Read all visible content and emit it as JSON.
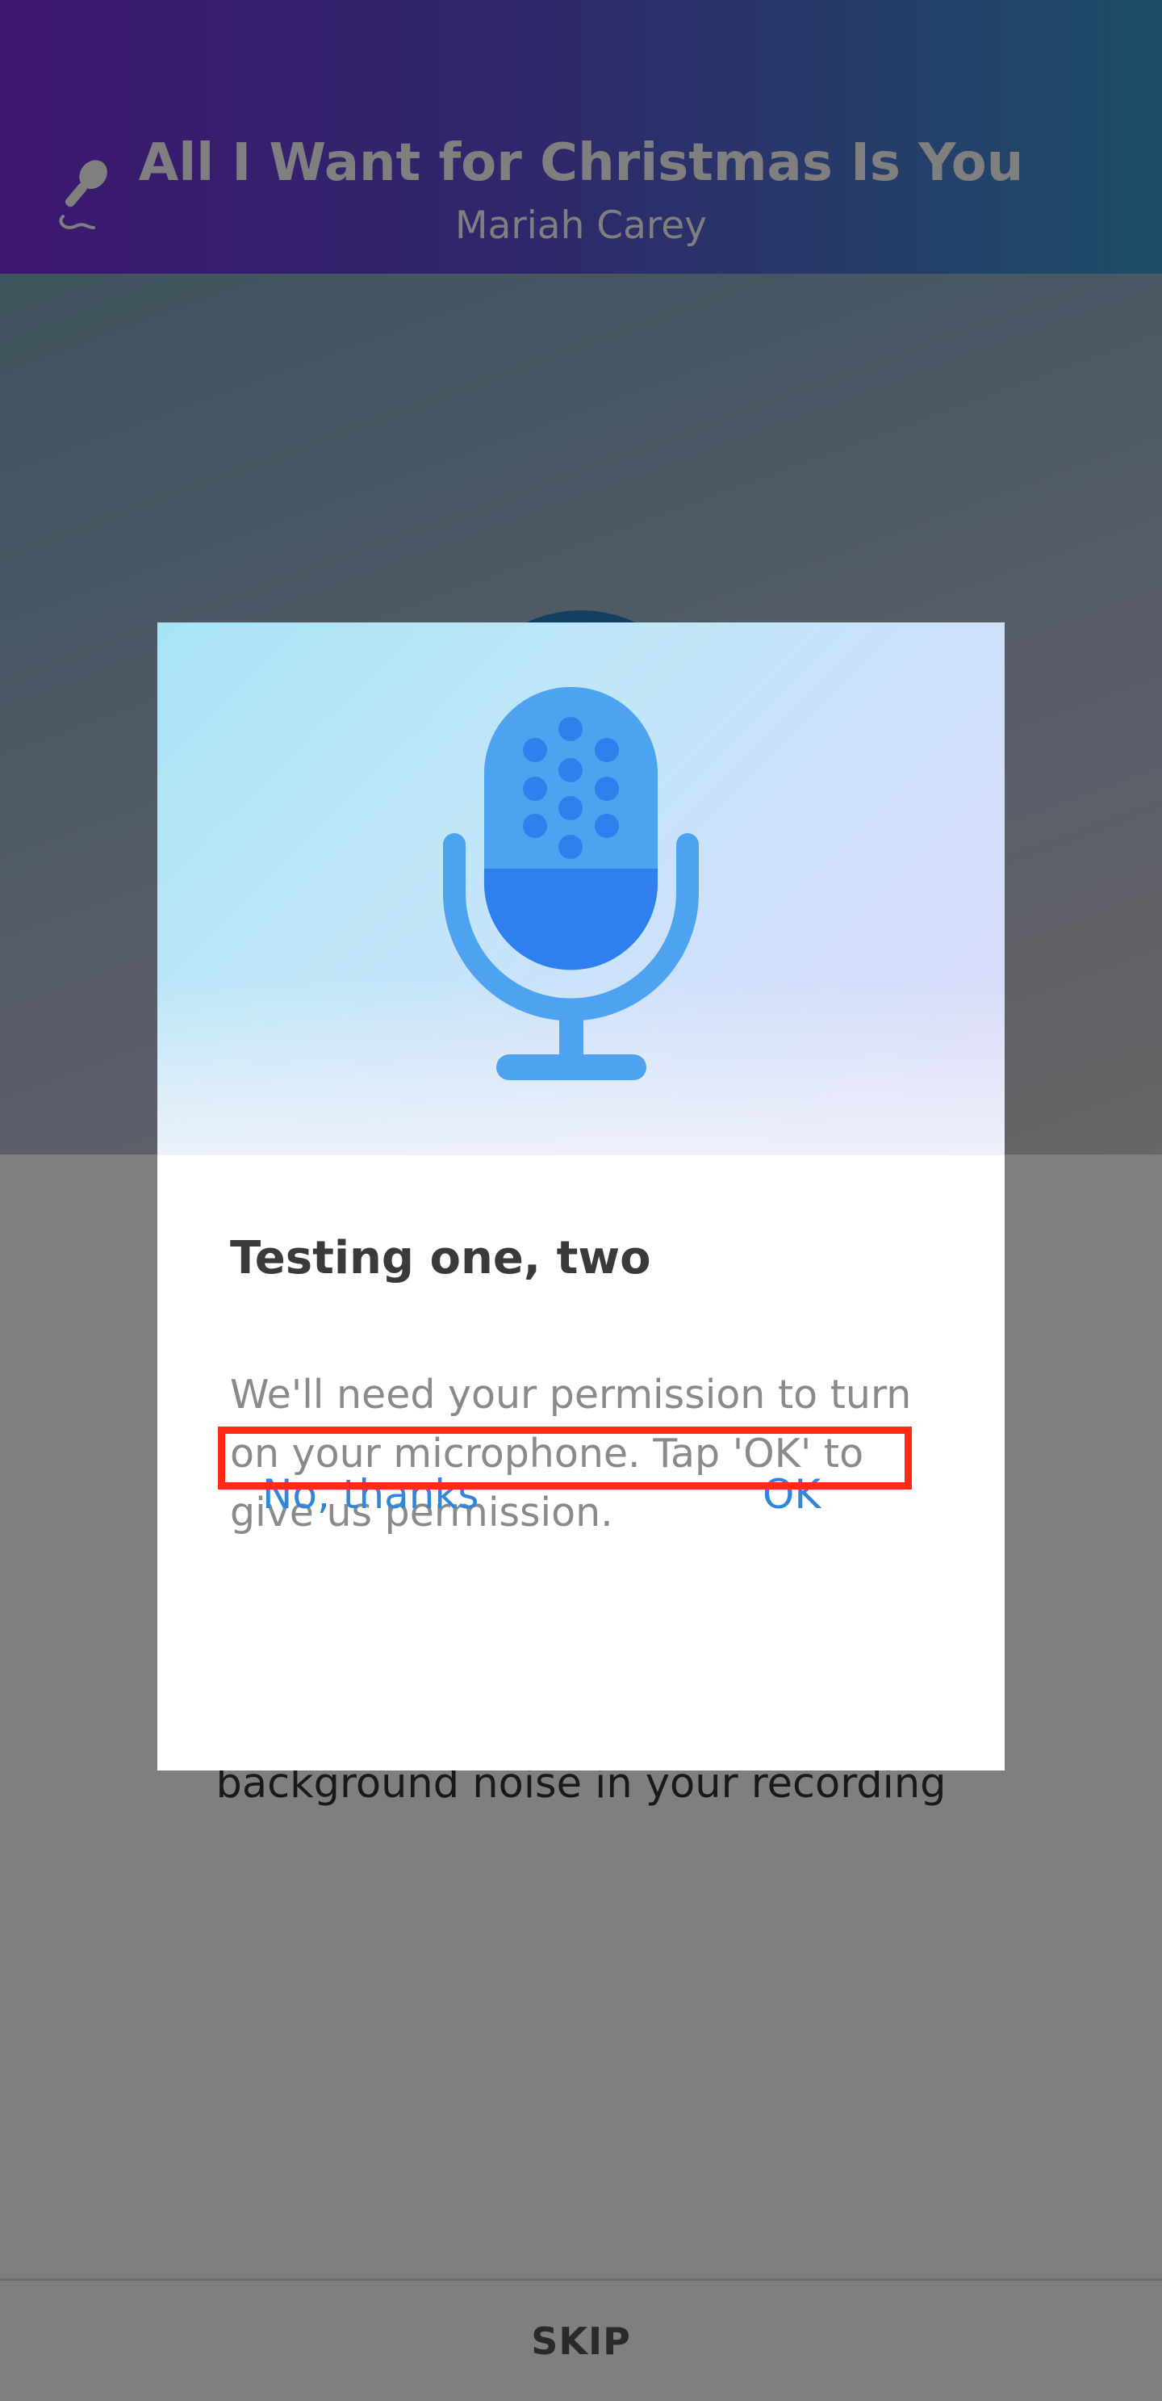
{
  "header": {
    "song_title": "All I Want for Christmas Is You",
    "artist": "Mariah Carey",
    "icon": "microphone-icon",
    "gradient": [
      "#7a2ee0",
      "#3a9bd0"
    ]
  },
  "background": {
    "caption": "background noise in your recording",
    "skip_label": "SKIP"
  },
  "dialog": {
    "hero_icon": "microphone-icon",
    "title": "Testing one, two",
    "body": "We'll need your permission to turn on your microphone. Tap 'OK' to give us permission.",
    "buttons": {
      "decline_label": "No,  thanks",
      "accept_label": "OK"
    },
    "accent_color": "#2e86de"
  },
  "annotation": {
    "highlight_color": "#ff2a14"
  }
}
